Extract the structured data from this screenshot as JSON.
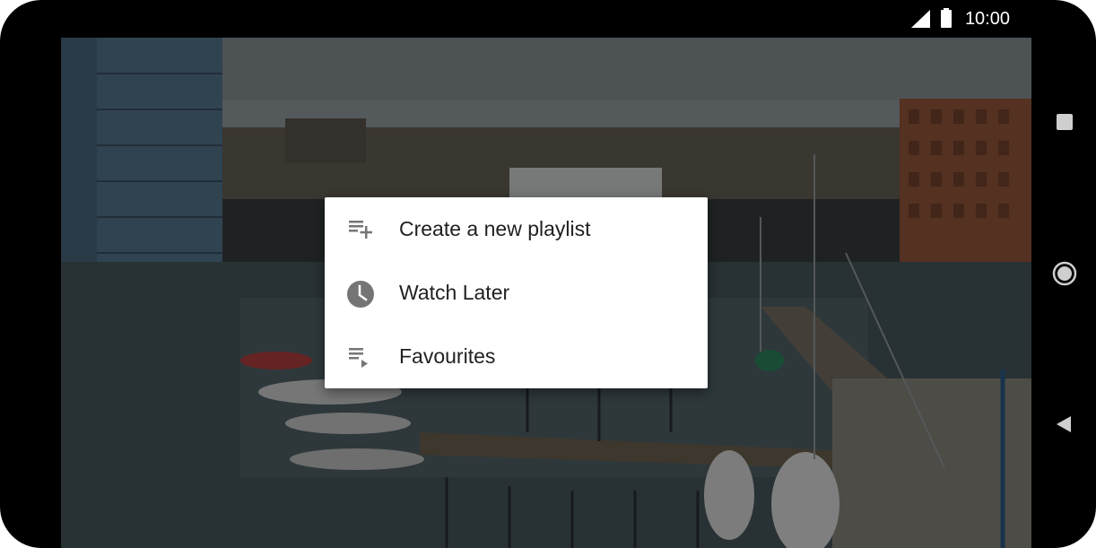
{
  "status_bar": {
    "time": "10:00",
    "icons": [
      "signal-icon",
      "battery-icon"
    ]
  },
  "menu": {
    "items": [
      {
        "label": "Create a new playlist",
        "icon": "playlist-add-icon"
      },
      {
        "label": "Watch Later",
        "icon": "clock-icon"
      },
      {
        "label": "Favourites",
        "icon": "playlist-play-icon"
      }
    ]
  },
  "nav_bar": {
    "buttons": [
      "overview-square-icon",
      "home-circle-icon",
      "back-triangle-icon"
    ]
  },
  "colors": {
    "menu_background": "#ffffff",
    "menu_text": "#212121",
    "icon_gray": "#757575",
    "scrim": "rgba(0,0,0,0.45)"
  }
}
